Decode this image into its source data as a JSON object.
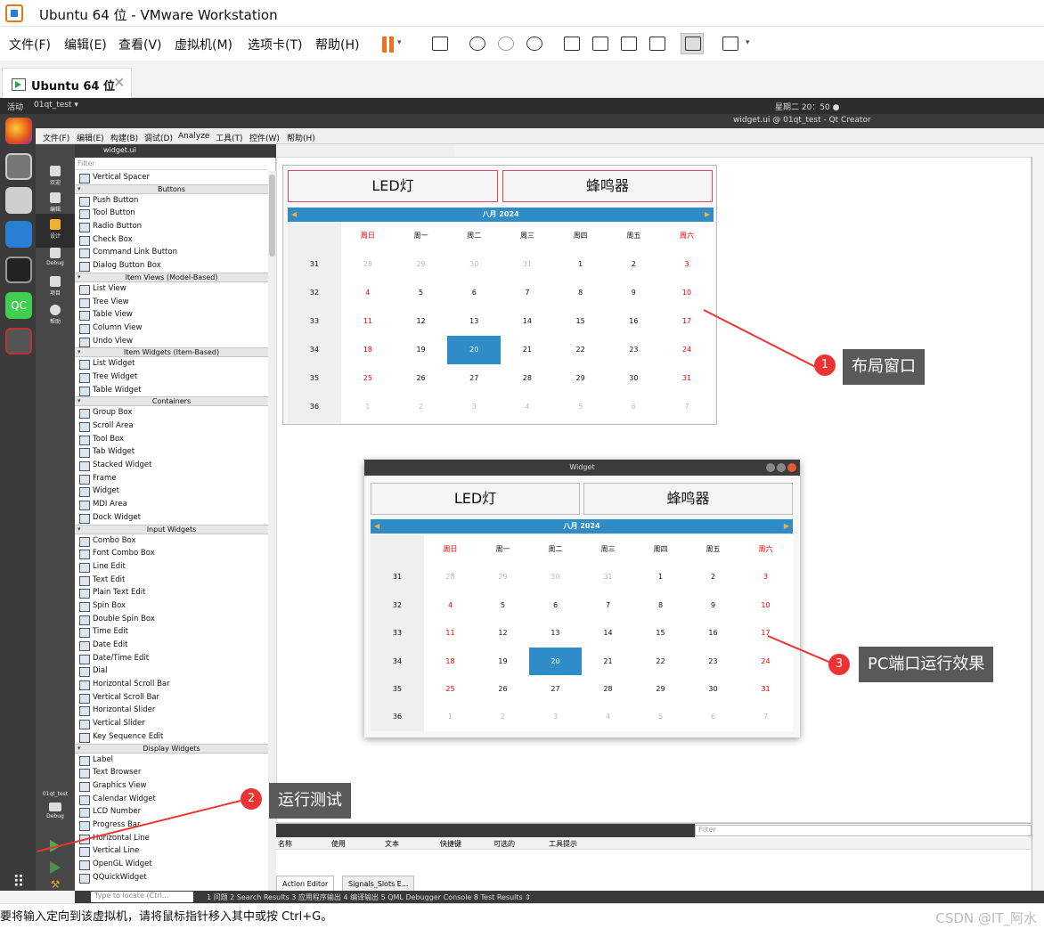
{
  "vm": {
    "title": "Ubuntu 64 位 - VMware Workstation",
    "menu": [
      "文件(F)",
      "编辑(E)",
      "查看(V)",
      "虚拟机(M)",
      "选项卡(T)",
      "帮助(H)"
    ],
    "tab_label": "Ubuntu 64 位",
    "status_text": "要将输入定向到该虚拟机，请将鼠标指针移入其中或按 Ctrl+G。",
    "watermark": "CSDN @IT_阿水"
  },
  "gnome": {
    "activities": "活动",
    "app": "01qt_test ▾",
    "clock": "星期二 20：50 ●"
  },
  "qt": {
    "window_title": "widget.ui @ 01qt_test - Qt Creator",
    "menu": [
      "文件(F)",
      "编辑(E)",
      "构建(B)",
      "调试(D)",
      "Analyze",
      "工具(T)",
      "控件(W)",
      "帮助(H)"
    ],
    "file_tab": "widget.ui",
    "modes": [
      "欢迎",
      "编辑",
      "设计",
      "Debug",
      "项目",
      "帮助"
    ],
    "kit_name": "01qt_test",
    "kit_mode": "Debug",
    "filter_placeholder": "Filter",
    "widget_box": [
      {
        "type": "item",
        "label": "Vertical Spacer"
      },
      {
        "type": "cat",
        "label": "Buttons"
      },
      {
        "type": "item",
        "label": "Push Button"
      },
      {
        "type": "item",
        "label": "Tool Button"
      },
      {
        "type": "item",
        "label": "Radio Button"
      },
      {
        "type": "item",
        "label": "Check Box"
      },
      {
        "type": "item",
        "label": "Command Link Button"
      },
      {
        "type": "item",
        "label": "Dialog Button Box"
      },
      {
        "type": "cat",
        "label": "Item Views (Model-Based)"
      },
      {
        "type": "item",
        "label": "List View"
      },
      {
        "type": "item",
        "label": "Tree View"
      },
      {
        "type": "item",
        "label": "Table View"
      },
      {
        "type": "item",
        "label": "Column View"
      },
      {
        "type": "item",
        "label": "Undo View"
      },
      {
        "type": "cat",
        "label": "Item Widgets (Item-Based)"
      },
      {
        "type": "item",
        "label": "List Widget"
      },
      {
        "type": "item",
        "label": "Tree Widget"
      },
      {
        "type": "item",
        "label": "Table Widget"
      },
      {
        "type": "cat",
        "label": "Containers"
      },
      {
        "type": "item",
        "label": "Group Box"
      },
      {
        "type": "item",
        "label": "Scroll Area"
      },
      {
        "type": "item",
        "label": "Tool Box"
      },
      {
        "type": "item",
        "label": "Tab Widget"
      },
      {
        "type": "item",
        "label": "Stacked Widget"
      },
      {
        "type": "item",
        "label": "Frame"
      },
      {
        "type": "item",
        "label": "Widget"
      },
      {
        "type": "item",
        "label": "MDI Area"
      },
      {
        "type": "item",
        "label": "Dock Widget"
      },
      {
        "type": "cat",
        "label": "Input Widgets"
      },
      {
        "type": "item",
        "label": "Combo Box"
      },
      {
        "type": "item",
        "label": "Font Combo Box"
      },
      {
        "type": "item",
        "label": "Line Edit"
      },
      {
        "type": "item",
        "label": "Text Edit"
      },
      {
        "type": "item",
        "label": "Plain Text Edit"
      },
      {
        "type": "item",
        "label": "Spin Box"
      },
      {
        "type": "item",
        "label": "Double Spin Box"
      },
      {
        "type": "item",
        "label": "Time Edit"
      },
      {
        "type": "item",
        "label": "Date Edit"
      },
      {
        "type": "item",
        "label": "Date/Time Edit"
      },
      {
        "type": "item",
        "label": "Dial"
      },
      {
        "type": "item",
        "label": "Horizontal Scroll Bar"
      },
      {
        "type": "item",
        "label": "Vertical Scroll Bar"
      },
      {
        "type": "item",
        "label": "Horizontal Slider"
      },
      {
        "type": "item",
        "label": "Vertical Slider"
      },
      {
        "type": "item",
        "label": "Key Sequence Edit"
      },
      {
        "type": "cat",
        "label": "Display Widgets"
      },
      {
        "type": "item",
        "label": "Label"
      },
      {
        "type": "item",
        "label": "Text Browser"
      },
      {
        "type": "item",
        "label": "Graphics View"
      },
      {
        "type": "item",
        "label": "Calendar Widget"
      },
      {
        "type": "item",
        "label": "LCD Number"
      },
      {
        "type": "item",
        "label": "Progress Bar"
      },
      {
        "type": "item",
        "label": "Horizontal Line"
      },
      {
        "type": "item",
        "label": "Vertical Line"
      },
      {
        "type": "item",
        "label": "OpenGL Widget"
      },
      {
        "type": "item",
        "label": "QQuickWidget"
      }
    ],
    "action_filter": "Filter",
    "action_headers": [
      "名称",
      "使用",
      "文本",
      "快捷键",
      "可选的",
      "工具提示"
    ],
    "bottom_tabs": [
      "Action Editor",
      "Signals_Slots E..."
    ],
    "locate_placeholder": "Type to locate (Ctrl...",
    "output_panes": "1 问题   2 Search Results   3 应用程序输出   4 编译输出   5 QML Debugger Console   8 Test Results   ⇕"
  },
  "form": {
    "led_button": "LED灯",
    "buzzer_button": "蜂鸣器",
    "run_window_title": "Widget"
  },
  "calendar": {
    "month_year": "八月  2024",
    "weekdays": [
      "周日",
      "周一",
      "周二",
      "周三",
      "周四",
      "周五",
      "周六"
    ],
    "weeks": [
      {
        "wk": "31",
        "days": [
          "28",
          "29",
          "30",
          "31",
          "1",
          "2",
          "3"
        ]
      },
      {
        "wk": "32",
        "days": [
          "4",
          "5",
          "6",
          "7",
          "8",
          "9",
          "10"
        ]
      },
      {
        "wk": "33",
        "days": [
          "11",
          "12",
          "13",
          "14",
          "15",
          "16",
          "17"
        ]
      },
      {
        "wk": "34",
        "days": [
          "18",
          "19",
          "20",
          "21",
          "22",
          "23",
          "24"
        ]
      },
      {
        "wk": "35",
        "days": [
          "25",
          "26",
          "27",
          "28",
          "29",
          "30",
          "31"
        ]
      },
      {
        "wk": "36",
        "days": [
          "1",
          "2",
          "3",
          "4",
          "5",
          "6",
          "7"
        ]
      }
    ],
    "selected": "20"
  },
  "annotations": [
    {
      "num": "1",
      "text": "布局窗口"
    },
    {
      "num": "2",
      "text": "运行测试"
    },
    {
      "num": "3",
      "text": "PC端口运行效果"
    }
  ],
  "colors": {
    "accent": "#308cc6",
    "weekend": "#e00000",
    "callout": "#595959",
    "badge": "#e33333"
  }
}
